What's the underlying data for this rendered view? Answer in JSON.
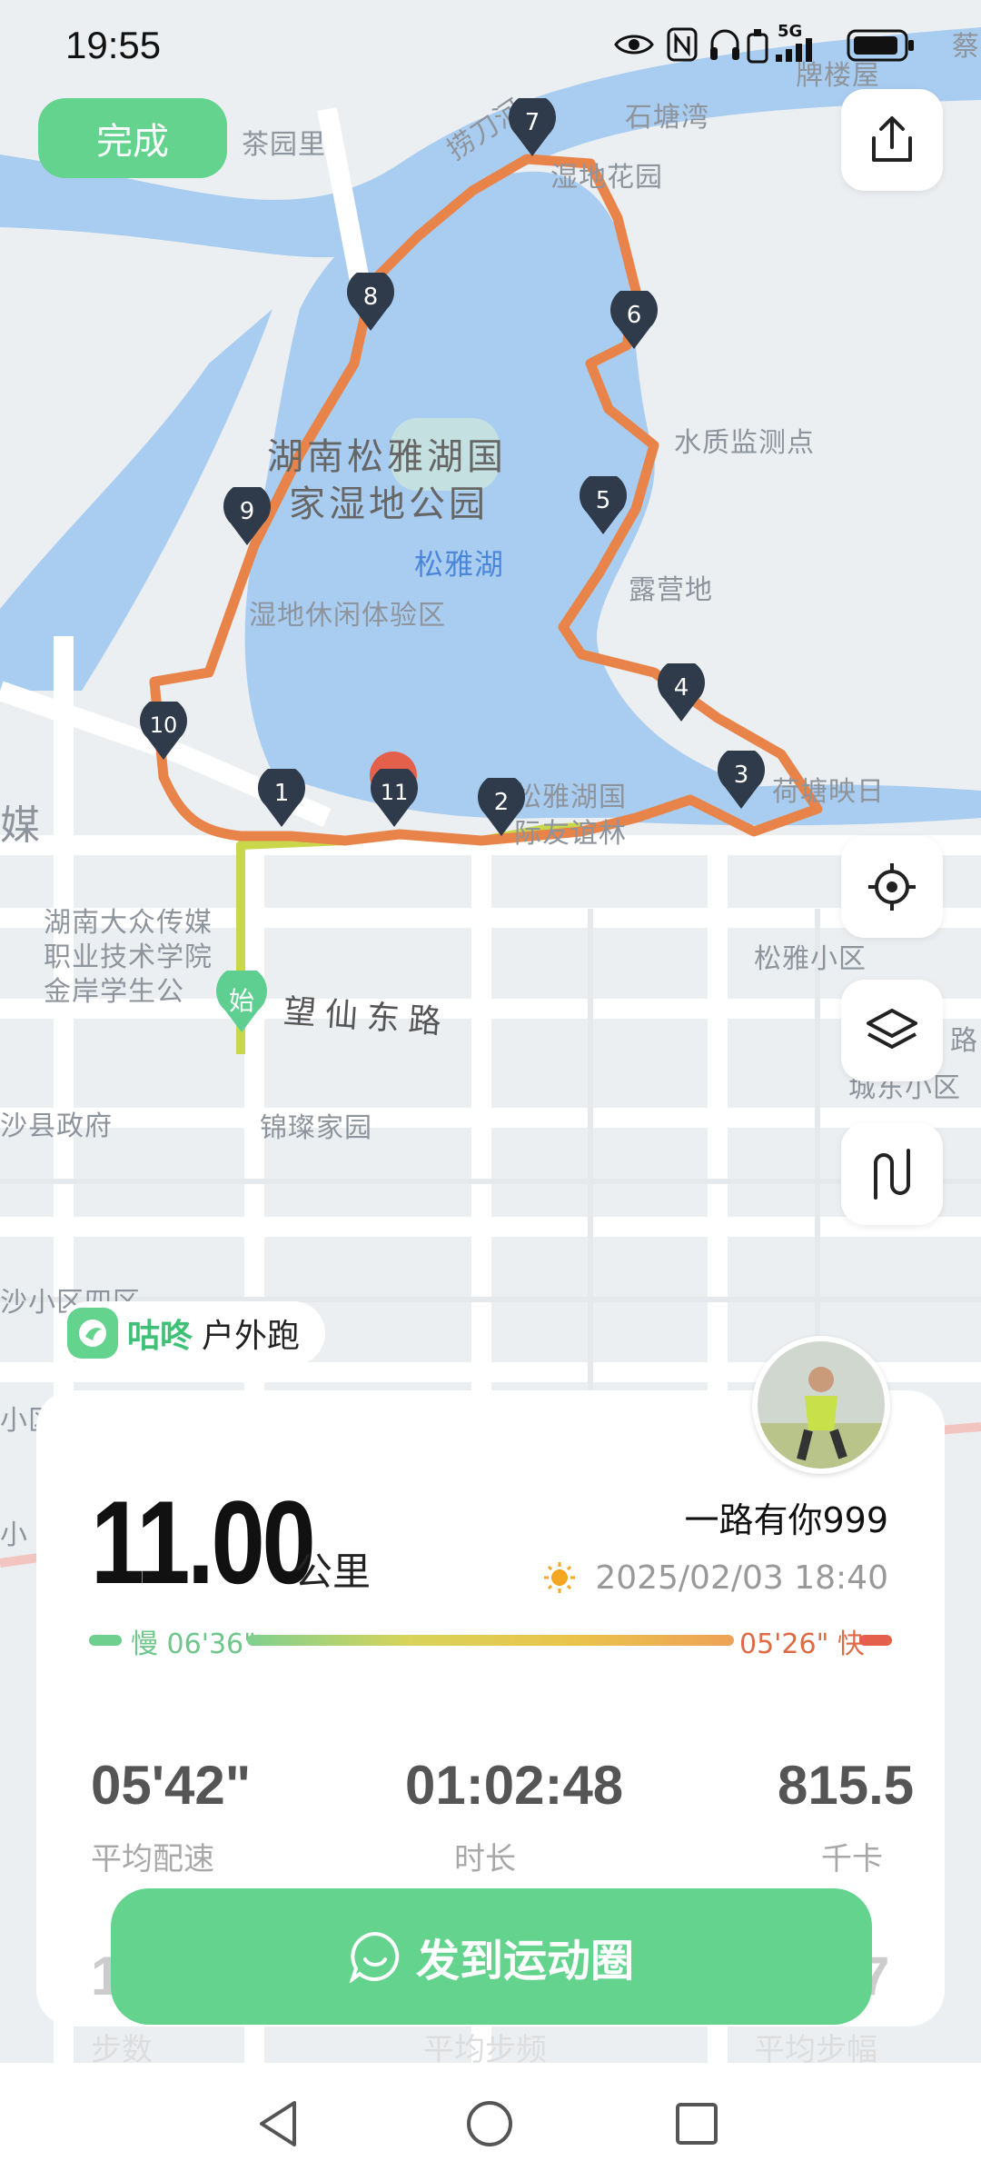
{
  "status": {
    "time": "19:55",
    "net": "5G"
  },
  "buttons": {
    "done": "完成"
  },
  "map_labels": {
    "river": "捞刀河",
    "shitangwan": "石塘湾",
    "paileiwu": "牌楼屋",
    "chayuanli": "茶园里",
    "shidihuayuan": "湿地花园",
    "park_line1": "湖南松雅湖国",
    "park_line2": "家湿地公园",
    "lake": "松雅湖",
    "experience": "湿地休闲体验区",
    "water_station": "水质监测点",
    "camp": "露营地",
    "hetang": "荷塘映日",
    "park2_line1": "松雅湖国",
    "park2_line2": "际友谊林",
    "college_line1": "湖南大众传媒",
    "college_line2": "职业技术学院",
    "college_line3": "金岸学生公",
    "road": "望仙东路",
    "songya_community": "松雅小区",
    "county_gov": "沙县政府",
    "jincan": "锦璨家园",
    "chengdong": "城东小区",
    "mei": "媒",
    "shaxiao": "沙小区四区",
    "start": "始",
    "cai": "蔡",
    "lu": "路",
    "xiao": "小区",
    "xiao2": "小"
  },
  "markers": [
    "1",
    "2",
    "3",
    "4",
    "5",
    "6",
    "7",
    "8",
    "9",
    "10",
    "11"
  ],
  "brand": {
    "name": "咕咚",
    "sub": "户外跑"
  },
  "summary": {
    "distance": "11.00",
    "distance_unit": "公里",
    "user": "一路有你999",
    "datetime": "2025/02/03 18:40",
    "slow_pace": "慢 06'36\"",
    "fast_pace": "05'26\" 快"
  },
  "stats": [
    {
      "value": "05'42\"",
      "label": "平均配速"
    },
    {
      "value": "01:02:48",
      "label": "时长"
    },
    {
      "value": "815.5",
      "label": "千卡"
    }
  ],
  "stats_row2": [
    {
      "value": "1",
      "label": "步数"
    },
    {
      "value": "",
      "label": "平均步频"
    },
    {
      "value": "7",
      "label": "平均步幅"
    }
  ],
  "share": {
    "label": "发到运动圈"
  },
  "colors": {
    "accent": "#63d38e",
    "route": "#e8844a",
    "start_route": "#c8d84a"
  }
}
